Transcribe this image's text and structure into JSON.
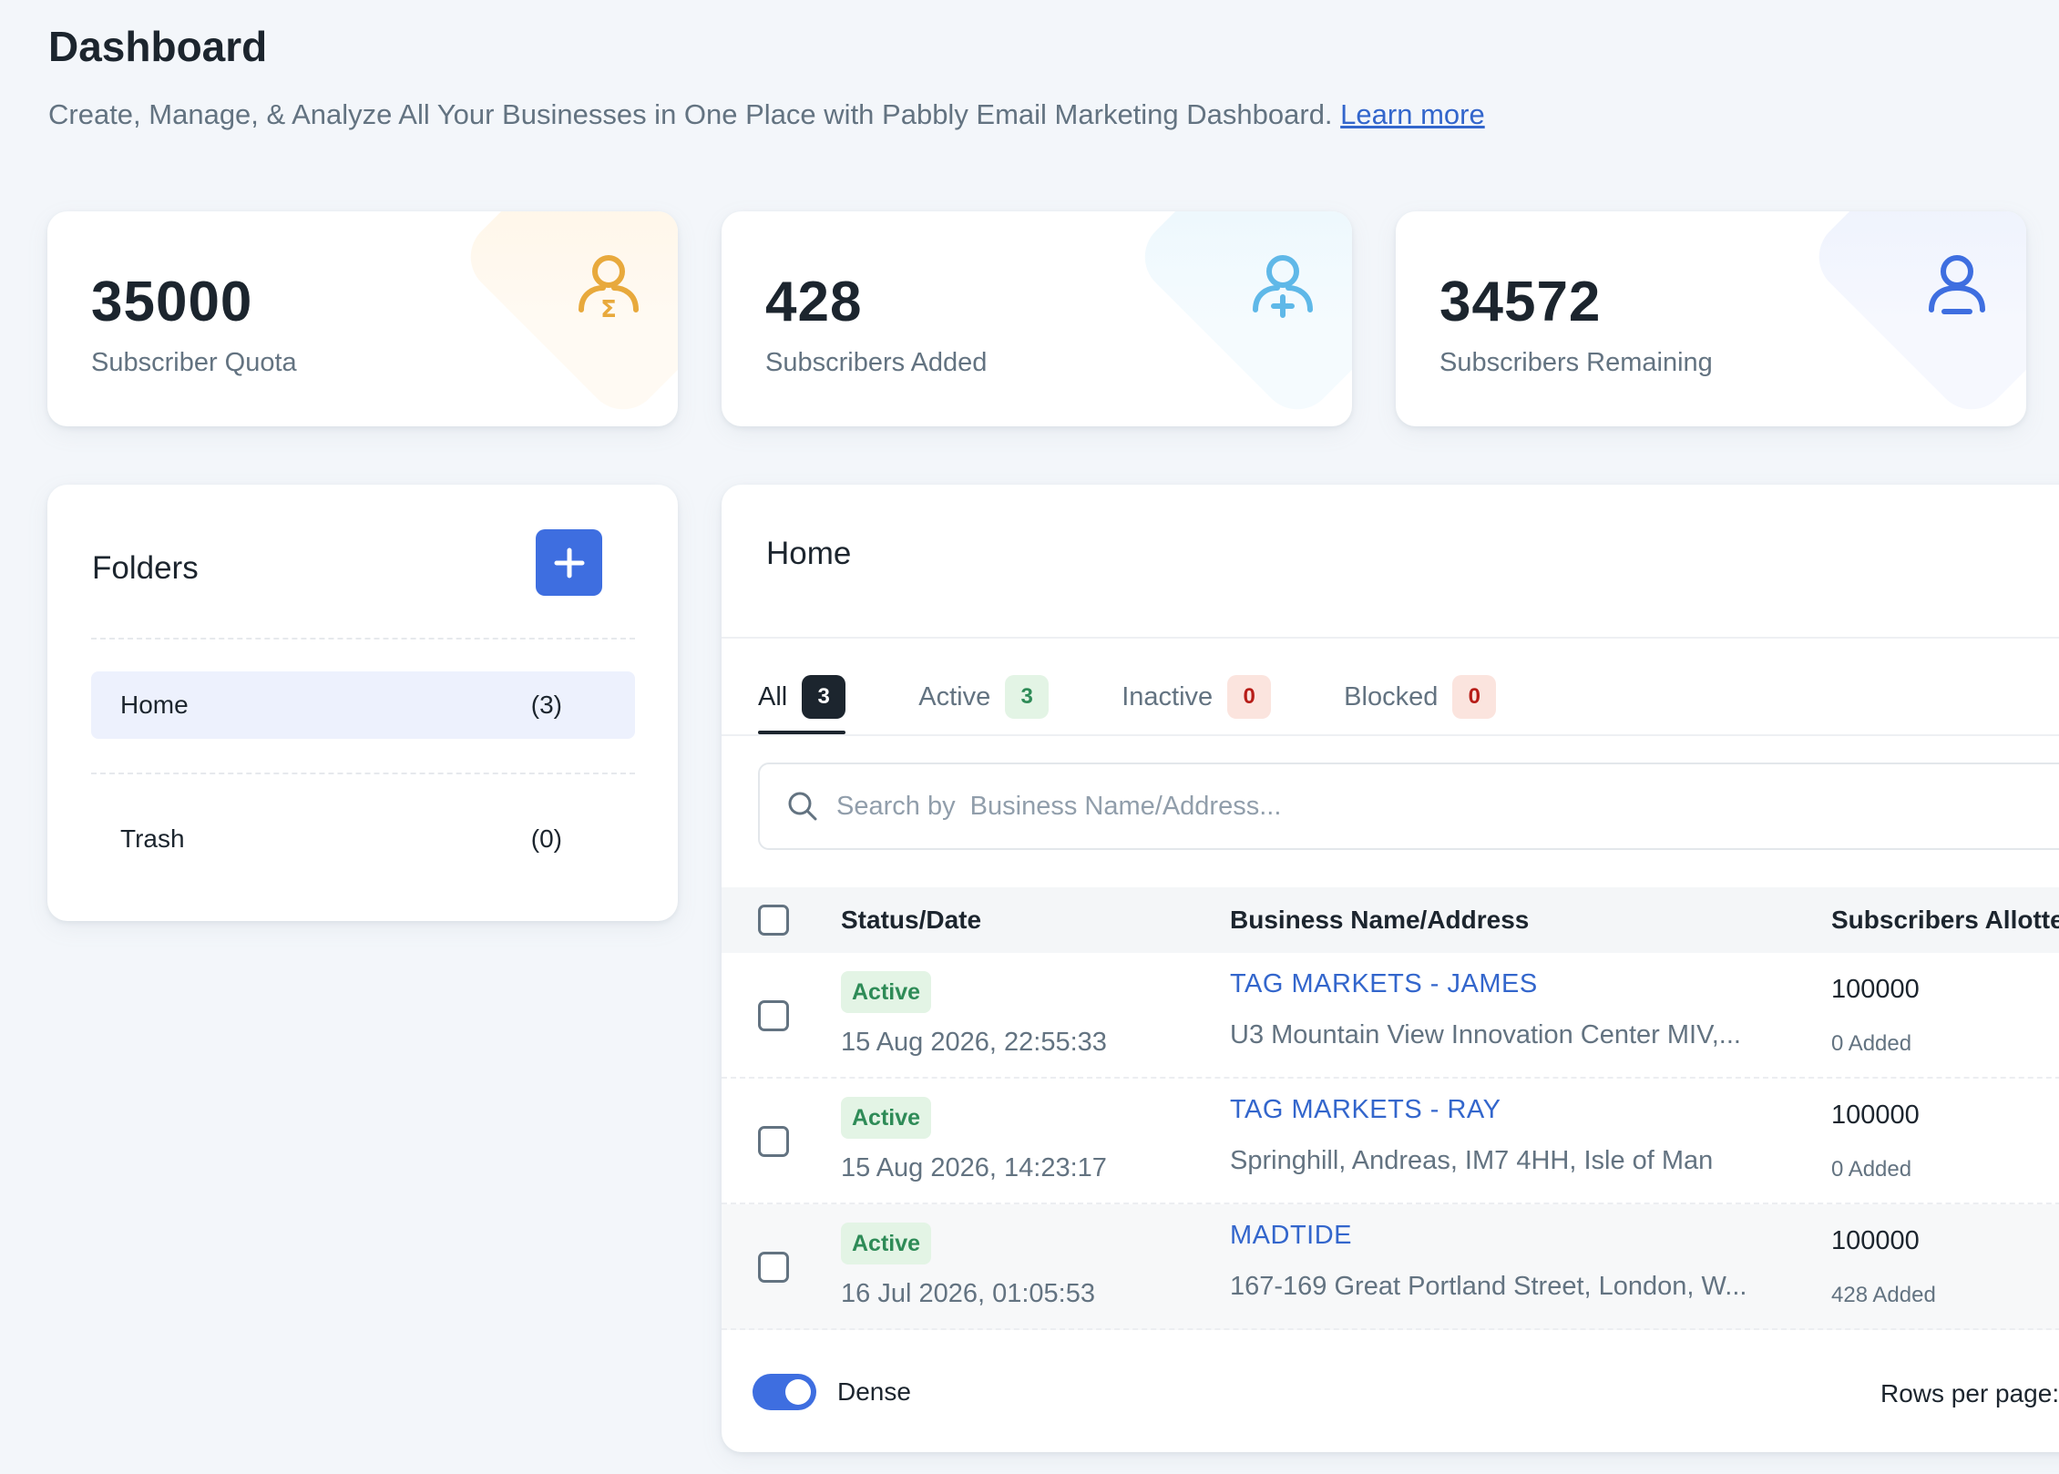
{
  "header": {
    "title": "Dashboard",
    "subtitle": "Create, Manage, & Analyze All Your Businesses in One Place with Pabbly Email Marketing Dashboard.",
    "learn_more": "Learn more"
  },
  "stats": [
    {
      "value": "35000",
      "label": "Subscriber Quota",
      "icon": "user-sigma-icon",
      "color": "#e8a93c",
      "tint": "#fff5e6"
    },
    {
      "value": "428",
      "label": "Subscribers Added",
      "icon": "user-plus-icon",
      "color": "#5fb8e8",
      "tint": "#eaf6fc"
    },
    {
      "value": "34572",
      "label": "Subscribers Remaining",
      "icon": "user-icon",
      "color": "#3e6ee0",
      "tint": "#ebf0fc"
    }
  ],
  "folders": {
    "title": "Folders",
    "add_icon": "plus-icon",
    "items": [
      {
        "name": "Home",
        "count": "(3)"
      },
      {
        "name": "Trash",
        "count": "(0)"
      }
    ]
  },
  "main": {
    "title": "Home",
    "tabs": [
      {
        "label": "All",
        "count": "3"
      },
      {
        "label": "Active",
        "count": "3"
      },
      {
        "label": "Inactive",
        "count": "0"
      },
      {
        "label": "Blocked",
        "count": "0"
      }
    ],
    "search_placeholder": "Search by  Business Name/Address...",
    "columns": [
      "Status/Date",
      "Business Name/Address",
      "Subscribers Allotte"
    ],
    "rows": [
      {
        "status": "Active",
        "date": "15 Aug 2026, 22:55:33",
        "name": "TAG MARKETS - JAMES",
        "address": "U3 Mountain View Innovation Center MIV,...",
        "subscribers": "100000",
        "added": "0 Added"
      },
      {
        "status": "Active",
        "date": "15 Aug 2026, 14:23:17",
        "name": "TAG MARKETS - RAY",
        "address": "Springhill, Andreas, IM7 4HH, Isle of Man",
        "subscribers": "100000",
        "added": "0 Added"
      },
      {
        "status": "Active",
        "date": "16 Jul 2026, 01:05:53",
        "name": "MADTIDE",
        "address": "167-169 Great Portland Street, London, W...",
        "subscribers": "100000",
        "added": "428 Added"
      }
    ],
    "dense_label": "Dense",
    "rows_per_page_label": "Rows per page:"
  },
  "colors": {
    "primary": "#3e6ee0",
    "link": "#3366cc",
    "success_bg": "#e3f4e5",
    "success_text": "#2e8b57"
  }
}
